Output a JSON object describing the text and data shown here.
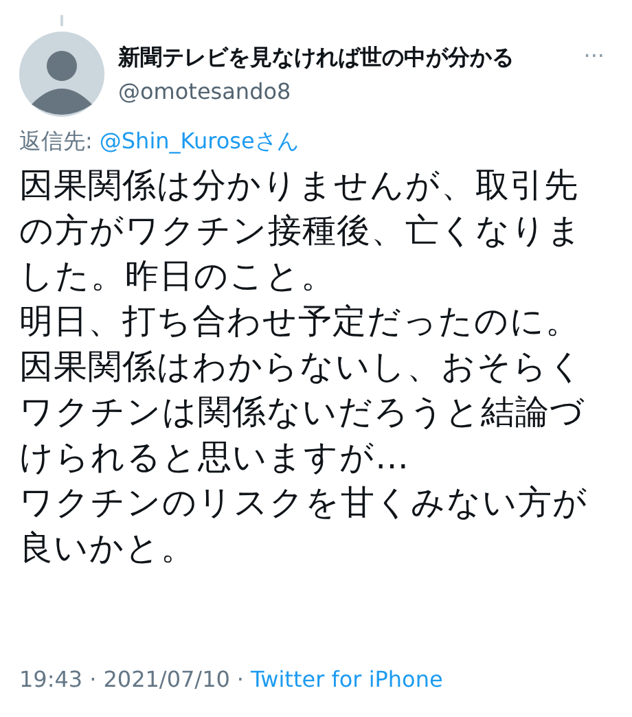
{
  "tweet": {
    "display_name": "新聞テレビを見なければ世の中が分かる",
    "handle": "@omotesando8",
    "more": "···",
    "reply_label": "返信先:",
    "reply_to": "@Shin_Kuroseさん",
    "lines": [
      "因果関係は分かりませんが、取引先",
      "の方がワクチン接種後、亡くなりま",
      "した。昨日のこと。",
      "明日、打ち合わせ予定だったのに。",
      "因果関係はわからないし、おそらく",
      "ワクチンは関係ないだろうと結論づ",
      "けられると思いますが…",
      "ワクチンのリスクを甘くみない方が",
      "良いかと。"
    ],
    "time": "19:43",
    "separator_1": "·",
    "date": "2021/07/10",
    "separator_2": "·",
    "source": "Twitter for iPhone"
  }
}
